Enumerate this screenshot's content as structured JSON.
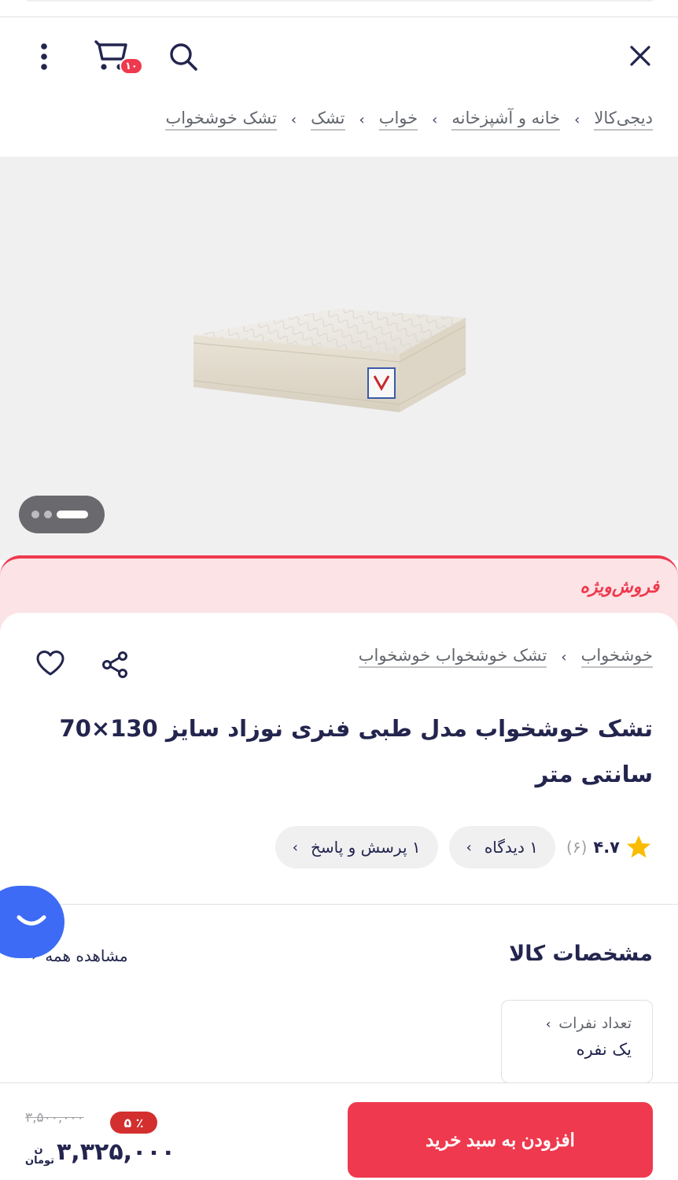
{
  "header": {
    "cart_count": "۱۰",
    "icons": [
      "close-icon",
      "search-icon",
      "cart-icon",
      "more-vertical-icon"
    ]
  },
  "breadcrumb": {
    "items": [
      "دیجی‌کالا",
      "خانه و آشپزخانه",
      "خواب",
      "تشک",
      "تشک خوشخواب"
    ],
    "separator": "›"
  },
  "gallery": {
    "image": "mattress-image",
    "dots": 3,
    "active_dot": 0
  },
  "sale": {
    "label": "فروش‌ویژه"
  },
  "product": {
    "brand": "خوشخواب",
    "category": "تشک خوشخواب خوشخواب",
    "separator": "›",
    "title": "تشک خوشخواب مدل طبی فنری نوزاد سایز 130×70 سانتی متر",
    "rating": "۴.۷",
    "rating_count": "(۶)",
    "comments_chip": "۱ دیدگاه",
    "qa_chip": "۱ پرسش و پاسخ",
    "chip_chevron": "›"
  },
  "specs": {
    "title": "مشخصات کالا",
    "see_all": "مشاهده همه",
    "chevron": "‹",
    "items": [
      {
        "label": "تعداد نفرات",
        "value": "یک نفره",
        "chevron": "›"
      }
    ]
  },
  "purchase": {
    "add_to_cart": "افزودن به سبد خرید",
    "old_price": "۳,۵۰۰,۰۰۰",
    "discount": "۵ ٪",
    "price": "۳,۳۲۵,۰۰۰",
    "currency_line1": "ن",
    "currency_line2": "تومان"
  },
  "colors": {
    "brand_red": "#ef394e",
    "discount_red": "#d32f2f",
    "chat_blue": "#3d6bf5",
    "text_dark": "#23254e",
    "text_muted": "#62666d",
    "gallery_bg": "#f0f0f1",
    "sale_bg": "#fbe3e6"
  }
}
